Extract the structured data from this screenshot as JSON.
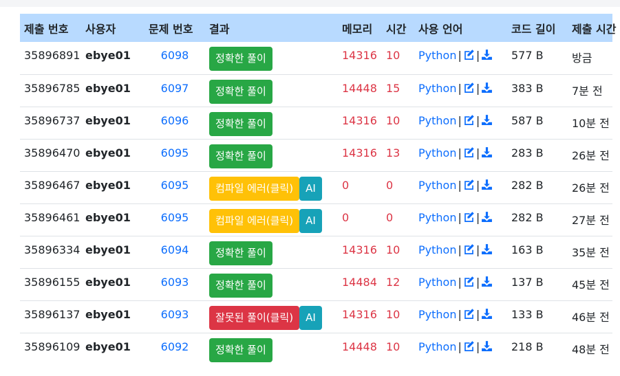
{
  "headers": {
    "id": "제출 번호",
    "user": "사용자",
    "problem": "문제 번호",
    "result": "결과",
    "memory": "메모리",
    "time": "시간",
    "language": "사용 언어",
    "length": "코드 길이",
    "submitted": "제출 시간"
  },
  "ai_label": "AI",
  "separator": "|",
  "colors": {
    "header_bg": "#b8daff",
    "accepted": "#28a745",
    "compile_error": "#ffc107",
    "wrong": "#dc3545",
    "ai": "#17a2b8",
    "link": "#0d6efd",
    "value_red": "#dc3545"
  },
  "icons": {
    "edit": "edit-icon",
    "download": "download-icon"
  },
  "rows": [
    {
      "id": "35896891",
      "user": "ebye01",
      "problem": "6098",
      "result": "정확한 풀이",
      "memory": "14316",
      "time": "10",
      "language": "Python",
      "length": "577 B",
      "submitted": "방금"
    },
    {
      "id": "35896785",
      "user": "ebye01",
      "problem": "6097",
      "result": "정확한 풀이",
      "memory": "14448",
      "time": "15",
      "language": "Python",
      "length": "383 B",
      "submitted": "7분 전"
    },
    {
      "id": "35896737",
      "user": "ebye01",
      "problem": "6096",
      "result": "정확한 풀이",
      "memory": "14316",
      "time": "10",
      "language": "Python",
      "length": "587 B",
      "submitted": "10분 전"
    },
    {
      "id": "35896470",
      "user": "ebye01",
      "problem": "6095",
      "result": "정확한 풀이",
      "memory": "14316",
      "time": "13",
      "language": "Python",
      "length": "283 B",
      "submitted": "26분 전"
    },
    {
      "id": "35896467",
      "user": "ebye01",
      "problem": "6095",
      "result": "컴파일 에러(클릭)",
      "memory": "0",
      "time": "0",
      "language": "Python",
      "length": "282 B",
      "submitted": "26분 전"
    },
    {
      "id": "35896461",
      "user": "ebye01",
      "problem": "6095",
      "result": "컴파일 에러(클릭)",
      "memory": "0",
      "time": "0",
      "language": "Python",
      "length": "282 B",
      "submitted": "27분 전"
    },
    {
      "id": "35896334",
      "user": "ebye01",
      "problem": "6094",
      "result": "정확한 풀이",
      "memory": "14316",
      "time": "10",
      "language": "Python",
      "length": "163 B",
      "submitted": "35분 전"
    },
    {
      "id": "35896155",
      "user": "ebye01",
      "problem": "6093",
      "result": "정확한 풀이",
      "memory": "14484",
      "time": "12",
      "language": "Python",
      "length": "137 B",
      "submitted": "45분 전"
    },
    {
      "id": "35896137",
      "user": "ebye01",
      "problem": "6093",
      "result": "잘못된 풀이(클릭)",
      "memory": "14316",
      "time": "10",
      "language": "Python",
      "length": "133 B",
      "submitted": "46분 전"
    },
    {
      "id": "35896109",
      "user": "ebye01",
      "problem": "6092",
      "result": "정확한 풀이",
      "memory": "14448",
      "time": "10",
      "language": "Python",
      "length": "218 B",
      "submitted": "48분 전"
    }
  ]
}
